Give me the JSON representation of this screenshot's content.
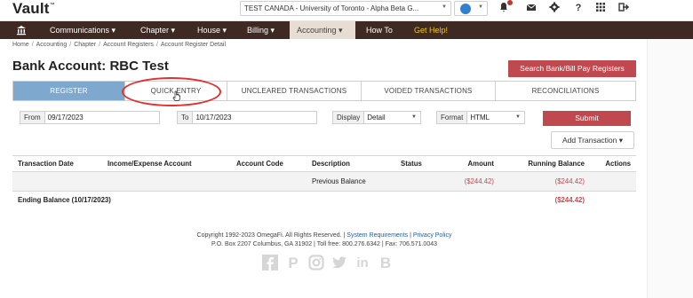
{
  "app": {
    "logo": "Vault",
    "trademark": "™"
  },
  "topbar": {
    "chapter_selected": "TEST CANADA - University of Toronto - Alpha Beta G...",
    "icons": [
      "bell-icon",
      "mail-icon",
      "gear-icon",
      "help-icon",
      "apps-grid-icon",
      "logout-icon"
    ]
  },
  "nav": {
    "items": [
      {
        "label": "Communications"
      },
      {
        "label": "Chapter"
      },
      {
        "label": "House"
      },
      {
        "label": "Billing"
      },
      {
        "label": "Accounting"
      },
      {
        "label": "How To"
      },
      {
        "label": "Get Help!"
      }
    ],
    "active": "Accounting"
  },
  "breadcrumb": [
    "Home",
    "Accounting",
    "Chapter",
    "Account Registers",
    "Account Register Detail"
  ],
  "page": {
    "title": "Bank Account: RBC Test",
    "search_button": "Search Bank/Bill Pay Registers"
  },
  "tabs": [
    {
      "label": "REGISTER",
      "active": true
    },
    {
      "label": "QUICK ENTRY",
      "active": false
    },
    {
      "label": "UNCLEARED TRANSACTIONS",
      "active": false
    },
    {
      "label": "VOIDED TRANSACTIONS",
      "active": false
    },
    {
      "label": "RECONCILIATIONS",
      "active": false
    }
  ],
  "filters": {
    "from_label": "From",
    "from_value": "09/17/2023",
    "to_label": "To",
    "to_value": "10/17/2023",
    "display_label": "Display",
    "display_value": "Detail",
    "format_label": "Format",
    "format_value": "HTML",
    "submit_label": "Submit"
  },
  "add_transaction_label": "Add Transaction",
  "table": {
    "headers": [
      "Transaction Date",
      "Income/Expense Account",
      "Account Code",
      "Description",
      "Status",
      "Amount",
      "Running Balance",
      "Actions"
    ],
    "rows": [
      [
        "",
        "",
        "",
        "Previous Balance",
        "",
        "($244.42)",
        "($244.42)",
        ""
      ]
    ],
    "ending_label": "Ending Balance (10/17/2023)",
    "ending_value": "($244.42)"
  },
  "footer": {
    "copyright": "Copyright 1992-2023 OmegaFi. All Rights Reserved. |",
    "link_requirements": "System Requirements",
    "pipe": "|",
    "link_privacy": "Privacy Policy",
    "address": "P.O. Box 2207 Columbus, GA 31902 | Toll free: 800.276.6342 | Fax: 706.571.0043",
    "social_icons": [
      "facebook-icon",
      "pinterest-icon",
      "instagram-icon",
      "twitter-icon",
      "linkedin-icon",
      "blogger-icon"
    ]
  },
  "colors": {
    "nav_bg": "#3f2a23",
    "accent_red": "#c0494f",
    "tab_active": "#7fa8cf",
    "negative": "#c0494f",
    "help_yellow": "#f0c419"
  }
}
